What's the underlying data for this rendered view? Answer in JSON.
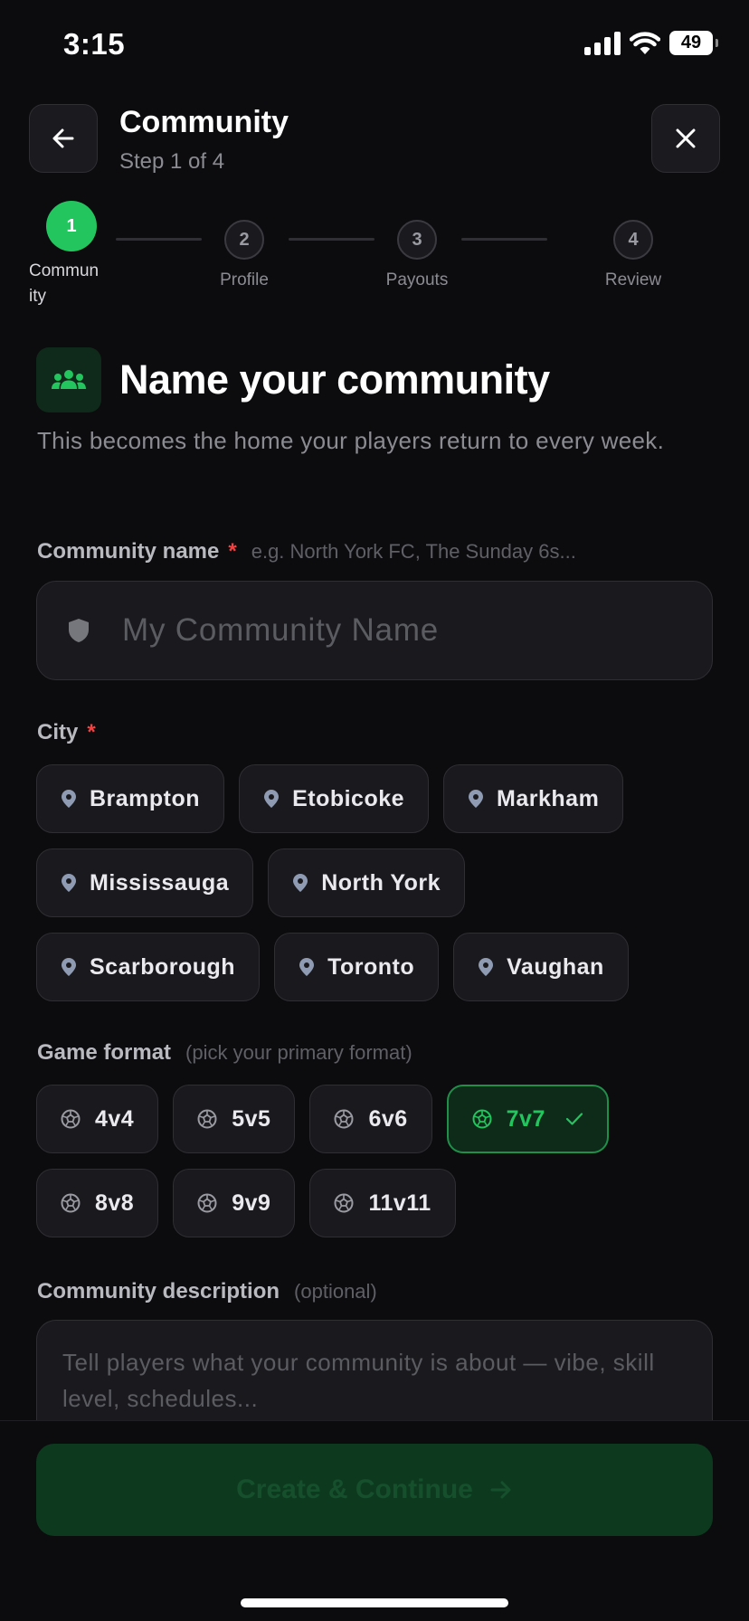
{
  "status": {
    "time": "3:15",
    "battery": "49"
  },
  "header": {
    "title": "Community",
    "subtitle": "Step 1 of 4"
  },
  "stepper": {
    "steps": [
      {
        "number": "1",
        "label": "Commun\nity",
        "active": true
      },
      {
        "number": "2",
        "label": "Profile"
      },
      {
        "number": "3",
        "label": "Payouts"
      },
      {
        "number": "4",
        "label": "Review"
      }
    ]
  },
  "section": {
    "title": "Name your community",
    "subtitle": "This becomes the home your players return to every week."
  },
  "name_field": {
    "label": "Community name",
    "required_mark": "*",
    "hint": "e.g. North York FC, The Sunday 6s...",
    "placeholder": "My Community Name",
    "value": ""
  },
  "city_field": {
    "label": "City",
    "required_mark": "*",
    "options": [
      "Brampton",
      "Etobicoke",
      "Markham",
      "Mississauga",
      "North York",
      "Scarborough",
      "Toronto",
      "Vaughan"
    ]
  },
  "format_field": {
    "label": "Game format",
    "hint": "(pick your primary format)",
    "options": [
      "4v4",
      "5v5",
      "6v6",
      "7v7",
      "8v8",
      "9v9",
      "11v11"
    ],
    "selected": "7v7"
  },
  "description_field": {
    "label": "Community description",
    "hint": "(optional)",
    "placeholder": "Tell players what your community is about — vibe, skill level, schedules..."
  },
  "cta": {
    "label": "Create & Continue"
  },
  "colors": {
    "accent": "#22c55e",
    "background": "#0c0c0f",
    "surface": "#1a1a1e",
    "required": "#ef4444"
  },
  "icons": {
    "back": "arrow-left-icon",
    "close": "close-icon",
    "community": "group-icon",
    "name": "shield-icon",
    "city": "map-pin-icon",
    "format": "soccer-ball-icon",
    "selected": "check-icon",
    "cta": "arrow-right-icon"
  }
}
